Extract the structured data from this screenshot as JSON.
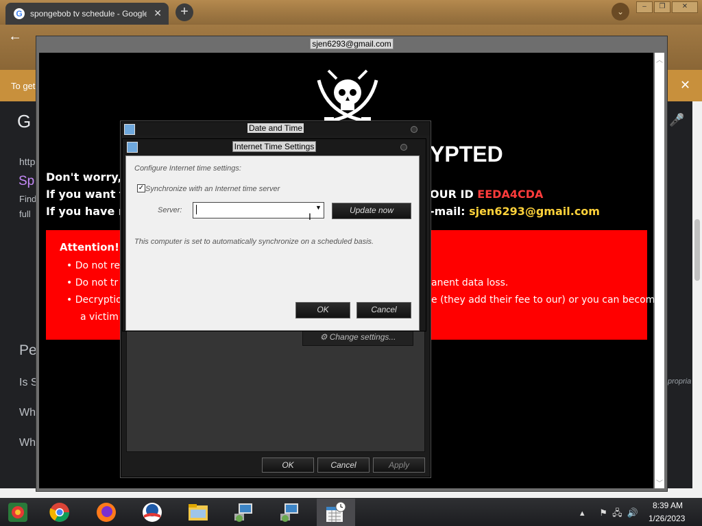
{
  "browser": {
    "tab_title": "spongebob tv schedule - Google Search",
    "tab_close": "✕",
    "new_tab": "+",
    "menu": "⌄",
    "infobar_text": "To get",
    "infobar_close": "✕",
    "left_fragments": [
      "G",
      "http",
      "Sp",
      "Find",
      "full",
      "Pe",
      "Is S",
      "Wh",
      "Wh"
    ],
    "propria": "propria"
  },
  "ransom": {
    "window_title": "sjen6293@gmail.com",
    "heading": "YPTED",
    "line1": "Don't worry,yo",
    "line2_start": "If you want to",
    "line2_end_label": "OUR ID",
    "line2_id": "EEDA4CDA",
    "line3_start": "If you have not",
    "line3_end_label": "-mail:",
    "line3_email": "sjen6293@gmail.com",
    "attention_title": "Attention!",
    "bullets_left": [
      "Do not re",
      "Do not tr",
      "Decryptio"
    ],
    "bullet2_right": "anent data loss.",
    "bullet3_right": "e (they add their fee to our) or you can become",
    "bullet3_cont": "a victim o"
  },
  "date_time_dialog": {
    "title": "Date and Time",
    "change_settings": "Change settings...",
    "ok": "OK",
    "cancel": "Cancel",
    "apply": "Apply"
  },
  "internet_time_dialog": {
    "title": "Internet Time Settings",
    "configure_label": "Configure Internet time settings:",
    "sync_label": "Synchronize with an Internet time server",
    "sync_checked": true,
    "server_label": "Server:",
    "server_value": "",
    "update_now": "Update now",
    "status_text": "This computer is set to automatically synchronize on a scheduled basis.",
    "ok": "OK",
    "cancel": "Cancel"
  },
  "taskbar": {
    "apps": [
      "start-icon",
      "chrome-icon",
      "firefox-icon",
      "obama-logo-icon",
      "file-explorer-icon",
      "network-computer-icon",
      "network-computer-icon",
      "date-time-icon"
    ],
    "clock_time": "8:39 AM",
    "clock_date": "1/26/2023"
  }
}
